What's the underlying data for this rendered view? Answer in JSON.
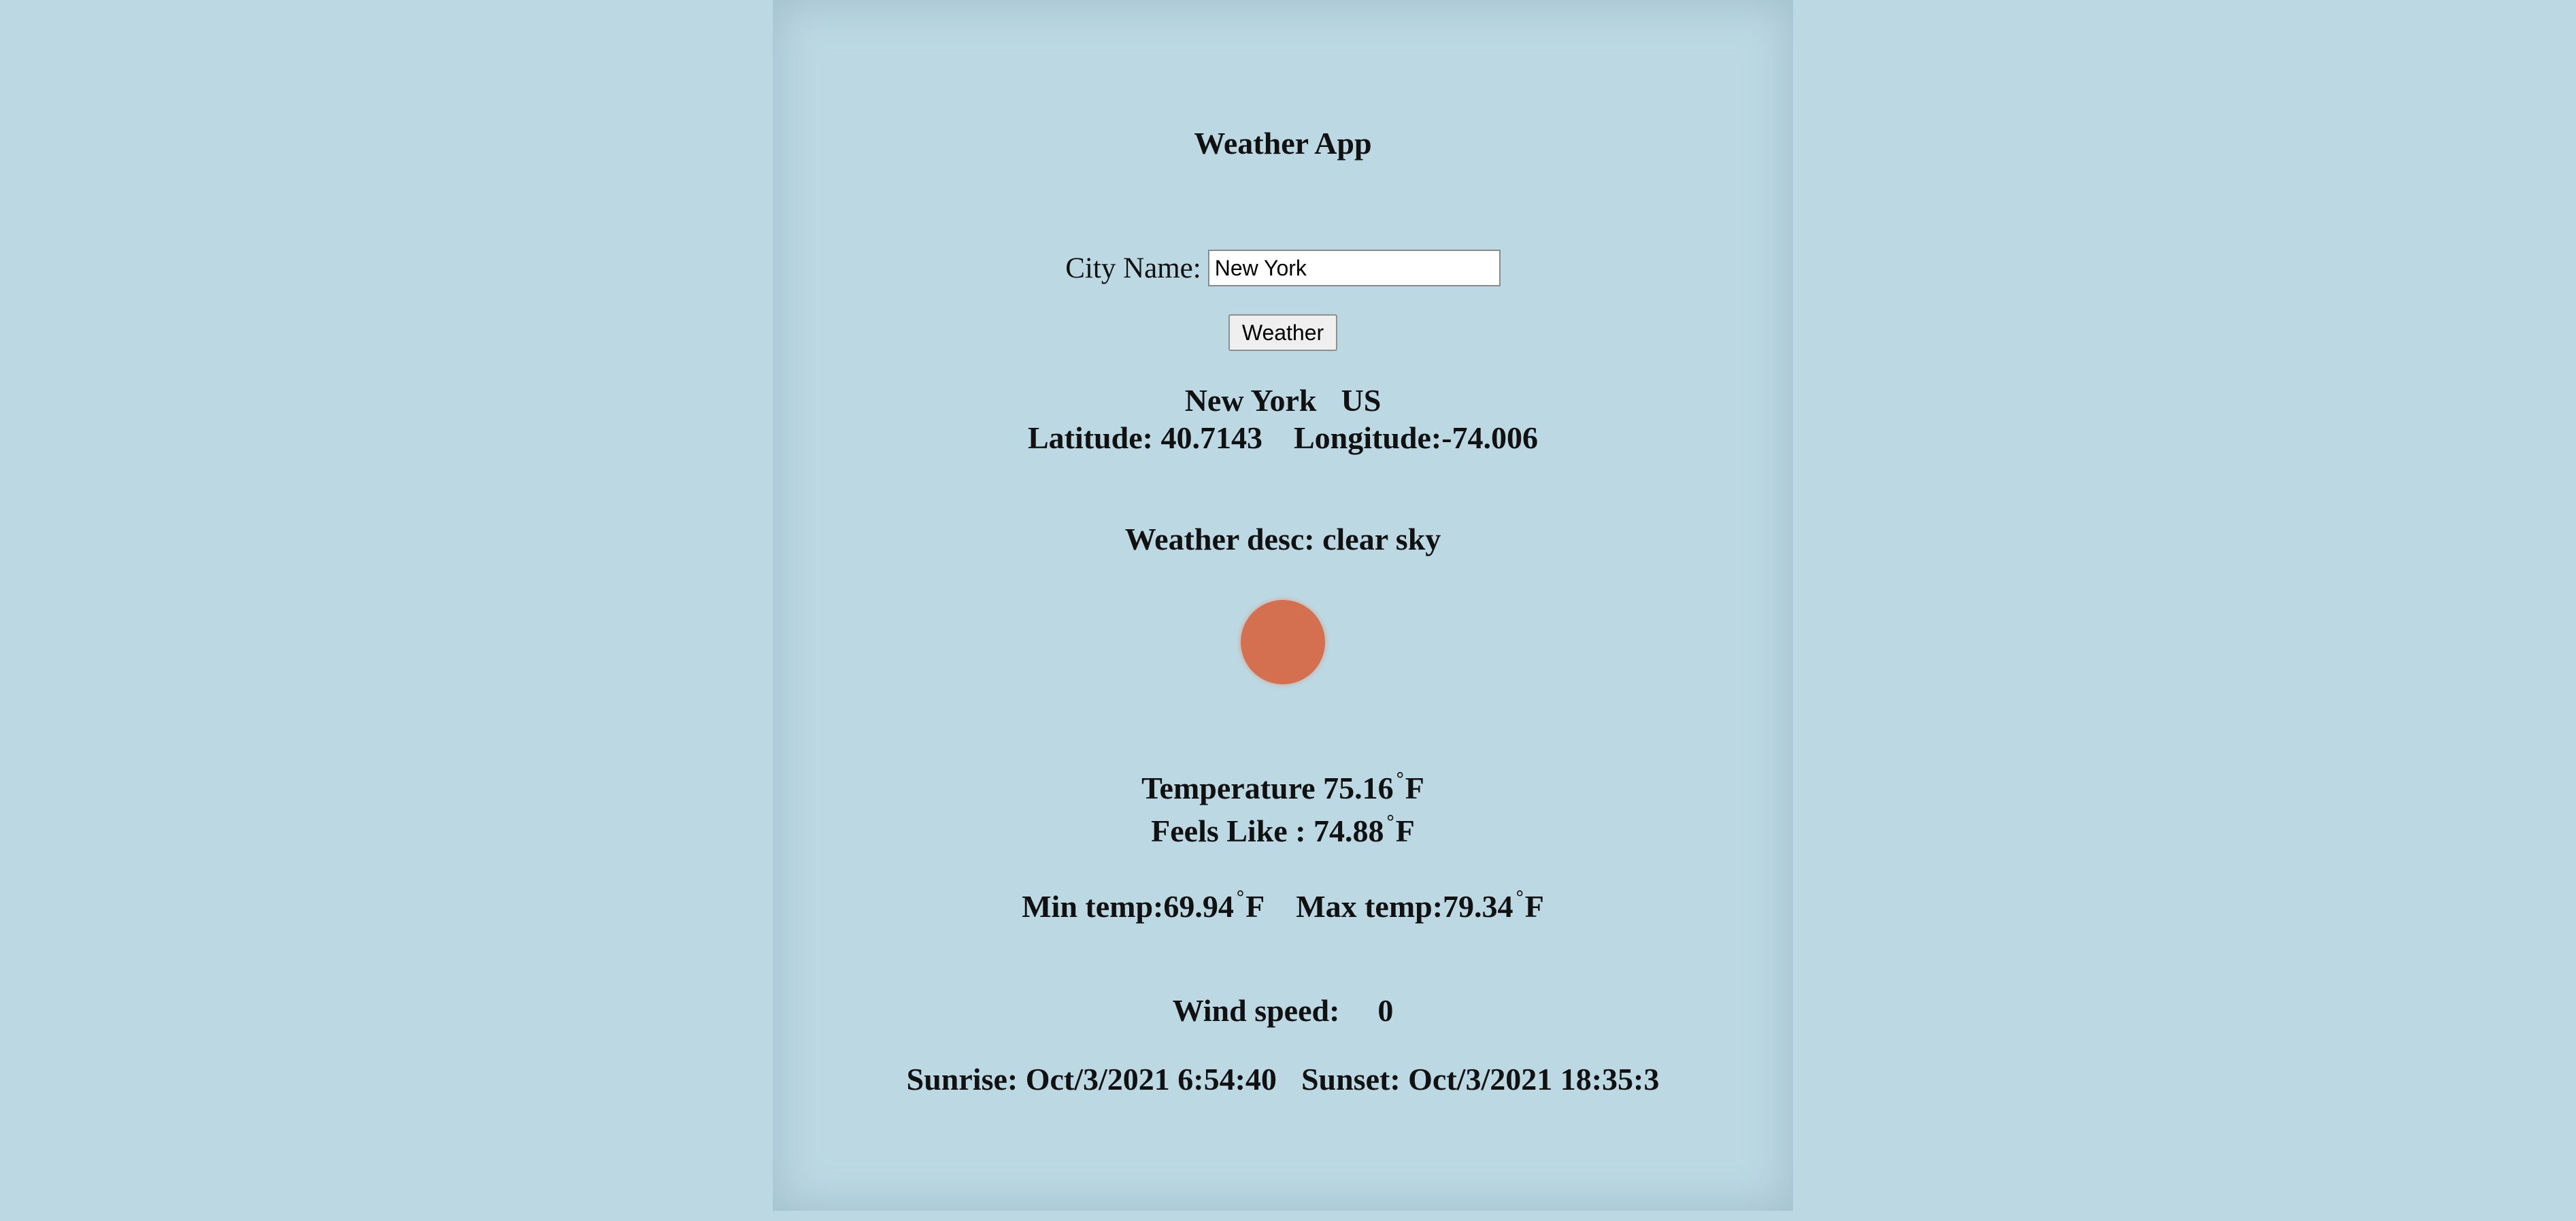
{
  "app": {
    "title": "Weather App"
  },
  "search": {
    "label": "City Name:",
    "value": "New York",
    "button_label": "Weather"
  },
  "location": {
    "city": "New York",
    "country": "US",
    "latitude_label": "Latitude: 40.7143",
    "longitude_label": "Longitude:-74.006"
  },
  "weather": {
    "description": "Weather desc: clear sky",
    "icon": "sun-icon",
    "icon_color": "#d4704f"
  },
  "temperature": {
    "temp_label": "Temperature 75.16",
    "feels_label": "Feels Like : 74.88",
    "min_label": "Min temp:69.94",
    "max_label": "Max temp:79.34",
    "degree_symbol": "°",
    "unit": "F"
  },
  "wind": {
    "label": "Wind speed:",
    "value": "0"
  },
  "sun_times": {
    "sunrise": "Sunrise: Oct/3/2021 6:54:40",
    "sunset": "Sunset: Oct/3/2021 18:35:3"
  },
  "colors": {
    "background": "#bcd9e3"
  }
}
